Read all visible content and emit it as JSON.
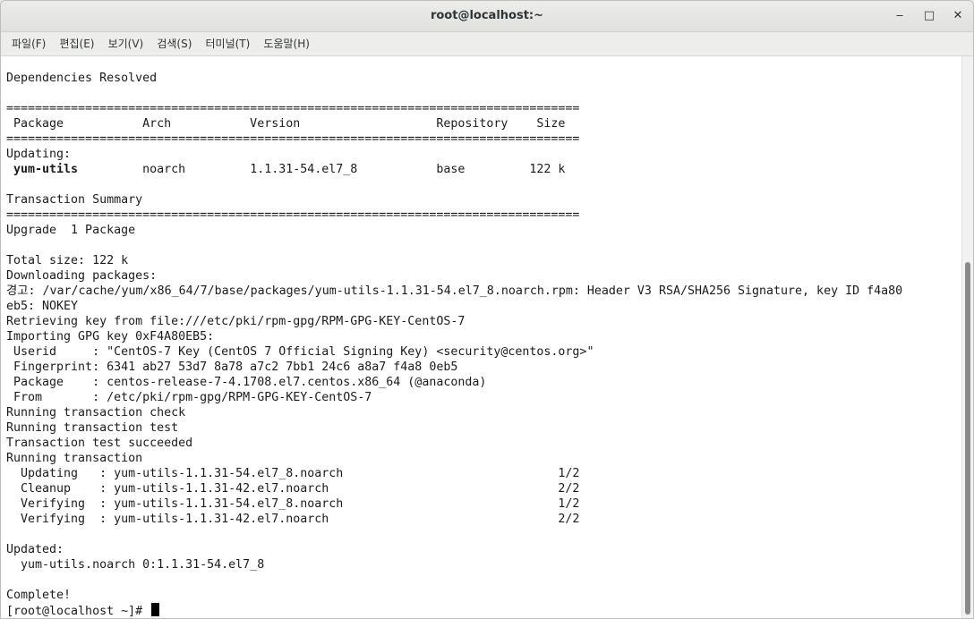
{
  "window": {
    "title": "root@localhost:~",
    "minimize_glyph": "‒",
    "maximize_glyph": "□",
    "close_glyph": "✕"
  },
  "menu": [
    {
      "label": "파일(F)"
    },
    {
      "label": "편집(E)"
    },
    {
      "label": "보기(V)"
    },
    {
      "label": "검색(S)"
    },
    {
      "label": "터미널(T)"
    },
    {
      "label": "도움말(H)"
    }
  ],
  "terminal": {
    "lines": [
      "Dependencies Resolved",
      "",
      "================================================================================",
      " Package           Arch           Version                   Repository    Size",
      "================================================================================",
      "Updating:",
      " yum-utils         noarch         1.1.31-54.el7_8           base         122 k",
      "",
      "Transaction Summary",
      "================================================================================",
      "Upgrade  1 Package",
      "",
      "Total size: 122 k",
      "Downloading packages:",
      "경고: /var/cache/yum/x86_64/7/base/packages/yum-utils-1.1.31-54.el7_8.noarch.rpm: Header V3 RSA/SHA256 Signature, key ID f4a80",
      "eb5: NOKEY",
      "Retrieving key from file:///etc/pki/rpm-gpg/RPM-GPG-KEY-CentOS-7",
      "Importing GPG key 0xF4A80EB5:",
      " Userid     : \"CentOS-7 Key (CentOS 7 Official Signing Key) <security@centos.org>\"",
      " Fingerprint: 6341 ab27 53d7 8a78 a7c2 7bb1 24c6 a8a7 f4a8 0eb5",
      " Package    : centos-release-7-4.1708.el7.centos.x86_64 (@anaconda)",
      " From       : /etc/pki/rpm-gpg/RPM-GPG-KEY-CentOS-7",
      "Running transaction check",
      "Running transaction test",
      "Transaction test succeeded",
      "Running transaction",
      "  Updating   : yum-utils-1.1.31-54.el7_8.noarch                              1/2",
      "  Cleanup    : yum-utils-1.1.31-42.el7.noarch                                2/2",
      "  Verifying  : yum-utils-1.1.31-54.el7_8.noarch                              1/2",
      "  Verifying  : yum-utils-1.1.31-42.el7.noarch                                2/2",
      "",
      "Updated:",
      "  yum-utils.noarch 0:1.1.31-54.el7_8",
      "",
      "Complete!"
    ],
    "prompt": "[root@localhost ~]# "
  }
}
